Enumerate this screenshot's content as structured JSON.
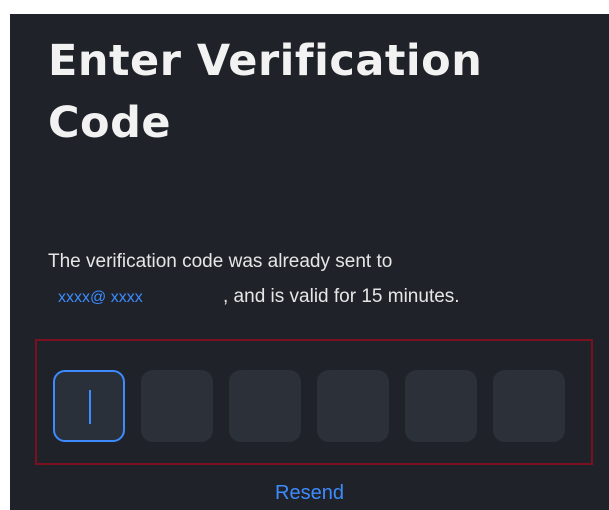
{
  "page": {
    "title": "Enter Verification Code",
    "description_line1": "The verification code was already sent to",
    "email": "xxxx@ xxxx",
    "description_line2_suffix": ", and is valid for 15 minutes.",
    "resend_label": "Resend"
  },
  "code": {
    "length": 6,
    "active_index": 0,
    "digits": [
      "",
      "",
      "",
      "",
      "",
      ""
    ]
  },
  "colors": {
    "background": "#1f2329",
    "accent": "#3d8bff",
    "input_bg": "#2c3139",
    "highlight_border": "#7a1020"
  }
}
